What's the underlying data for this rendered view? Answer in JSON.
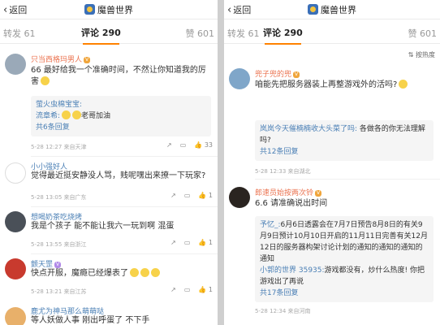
{
  "left": {
    "back": "返回",
    "title": "魔兽世界",
    "tab_repost": "转发 61",
    "tab_comment": "评论 290",
    "tab_like": "赞 601",
    "comments": [
      {
        "user": "只当西格玛男人",
        "text": "66 最好给我一个准确时间，不然让你知道我的厉害",
        "meta": "5-28 12:27  来自天津",
        "likes": "33",
        "replies": [
          {
            "name": "萤火虫棉宝宝:",
            "text": ""
          },
          {
            "name": "流章希:",
            "text": "老哥加油"
          }
        ],
        "more": "共6条回复"
      },
      {
        "user": "小小强好人",
        "text": "觉得最近挺安静没人骂，贱呢嘿出来撩一下玩家?",
        "meta": "5-28 13:05  来自广东",
        "likes": "1"
      },
      {
        "user": "想喝奶茶吃烧烤",
        "text": "我是个孩子 能不能让我六一玩到啊 混蛋",
        "meta": "5-28 13:55  来自浙江",
        "likes": "1"
      },
      {
        "user": "颤天罡",
        "text": "快点开服，魔瘾已经爆表了",
        "meta": "5-28 13:21  来自江苏",
        "likes": "1"
      },
      {
        "user": "鹿尤为神马那么萌萌哒",
        "text": "等人妖做人事 刚出呼蛋了 不下手",
        "meta": "",
        "likes": ""
      }
    ]
  },
  "right": {
    "back": "返回",
    "title": "魔兽世界",
    "tab_repost": "转发 61",
    "tab_comment": "评论 290",
    "tab_like": "赞 601",
    "sort": "按热度",
    "comments": [
      {
        "user": "兜子兜的兜",
        "text": "咱能先把服务器装上再整游戏外的活吗?",
        "meta": "5-28 12:33  来自湖北",
        "likes": "",
        "replies": [
          {
            "name": "岚岚今天催楠楠收大头菜了吗:",
            "text": "各做各的你无法理解吗?"
          }
        ],
        "more": "共12条回复"
      },
      {
        "user": "郎速员始按两次铃",
        "text": "6.6 请准确说出时间",
        "meta": "5-28 12:34  来自河南",
        "likes": "",
        "replies": [
          {
            "name": "予忆_:",
            "text": "6月6日透露会在7月7日预告8月8日的有关9月9日预计10月10日开启的11月11日完善有关12月12日的服务器构架讨论计划的通知的通知的通知的通知"
          },
          {
            "name": "小郭的世界 35935:",
            "text": "游戏都没有，炒什么热度! 你把游戏出了再说"
          }
        ],
        "more": "共17条回复"
      }
    ]
  },
  "colors": {
    "accent": "#ff8200",
    "link": "#4a7fb5",
    "name": "#eb7350"
  }
}
